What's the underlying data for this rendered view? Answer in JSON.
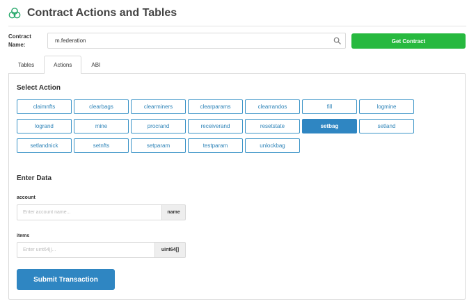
{
  "header": {
    "title": "Contract Actions and Tables",
    "logo_icon": "linked-circles-logo-icon",
    "accent": "#27a96b"
  },
  "contract": {
    "label": "Contract Name:",
    "value": "m.federation",
    "search_icon": "search-icon",
    "button_label": "Get Contract",
    "button_color": "#27b93f"
  },
  "tabs": [
    {
      "label": "Tables",
      "active": false
    },
    {
      "label": "Actions",
      "active": true
    },
    {
      "label": "ABI",
      "active": false
    }
  ],
  "select_action": {
    "title": "Select Action",
    "selected": "setbag",
    "rows": [
      [
        "claimnfts",
        "clearbags",
        "clearminers",
        "clearparams",
        "clearrandos",
        "fill",
        "logmine"
      ],
      [
        "logrand",
        "mine",
        "procrand",
        "receiverand",
        "resetstate",
        "setbag",
        "setland"
      ],
      [
        "setlandnick",
        "setnfts",
        "setparam",
        "testparam",
        "unlockbag"
      ]
    ]
  },
  "enter_data": {
    "title": "Enter Data",
    "fields": [
      {
        "label": "account",
        "placeholder": "Enter account name...",
        "type": "name"
      },
      {
        "label": "items",
        "placeholder": "Enter uint64[]...",
        "type": "uint64[]"
      }
    ]
  },
  "submit": {
    "label": "Submit Transaction",
    "color": "#2f86c2"
  }
}
